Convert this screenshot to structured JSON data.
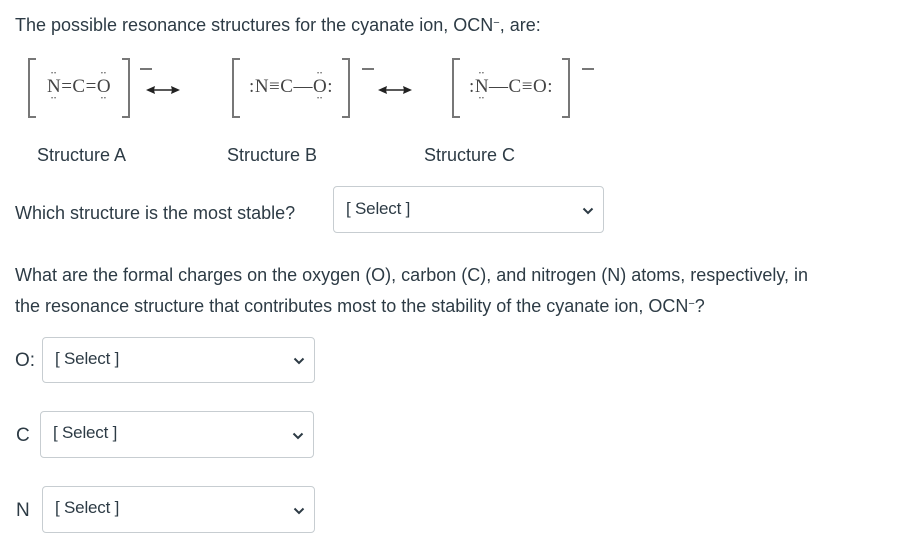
{
  "intro": {
    "text_before": "The possible resonance structures for the cyanate ion, OCN",
    "superscript": "−",
    "text_after": ", are:"
  },
  "structures": [
    {
      "label": "Structure A",
      "charge": "−",
      "atoms": [
        "N",
        "C",
        "O"
      ],
      "bonds": [
        "=",
        "="
      ],
      "lone_pairs": {
        "N": 2,
        "C": 0,
        "O": 2
      }
    },
    {
      "label": "Structure B",
      "charge": "−",
      "atoms": [
        "N",
        "C",
        "O"
      ],
      "bonds": [
        "≡",
        "—"
      ],
      "lone_pairs": {
        "N": 1,
        "C": 0,
        "O": 3
      }
    },
    {
      "label": "Structure C",
      "charge": "−",
      "atoms": [
        "N",
        "C",
        "O"
      ],
      "bonds": [
        "—",
        "≡"
      ],
      "lone_pairs": {
        "N": 3,
        "C": 0,
        "O": 1
      }
    }
  ],
  "resonance_arrow_icon": "double-headed-arrow",
  "question1": {
    "text": "Which structure is the most stable?",
    "select": {
      "value": "[ Select ]",
      "icon": "chevron-down"
    }
  },
  "question2": {
    "line1": "What are the formal charges on the oxygen (O), carbon (C), and nitrogen (N) atoms, respectively, in",
    "line2_before": "the resonance structure that contributes most to the stability of the cyanate ion, OCN",
    "line2_sup": "−",
    "line2_after": "?"
  },
  "formal_charges": [
    {
      "label": "O:",
      "value": "[ Select ]"
    },
    {
      "label": "C",
      "value": "[ Select ]"
    },
    {
      "label": "N",
      "value": "[ Select ]"
    }
  ]
}
